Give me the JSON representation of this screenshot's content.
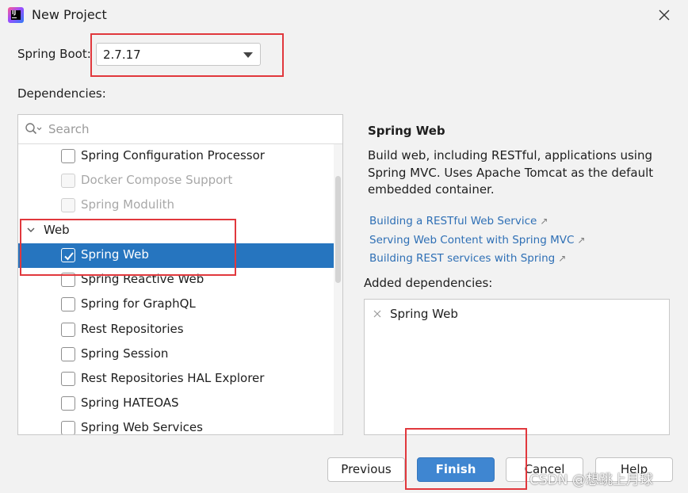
{
  "window": {
    "title": "New Project",
    "app_icon": "intellij-idea-icon",
    "close_icon": "close-icon"
  },
  "spring_boot": {
    "label": "Spring Boot:",
    "value": "2.7.17"
  },
  "dependencies": {
    "label": "Dependencies:",
    "search_placeholder": "Search",
    "rows": [
      {
        "label": "Spring Configuration Processor",
        "type": "item",
        "checked": false,
        "disabled": false
      },
      {
        "label": "Docker Compose Support",
        "type": "item",
        "checked": false,
        "disabled": true
      },
      {
        "label": "Spring Modulith",
        "type": "item",
        "checked": false,
        "disabled": true
      },
      {
        "label": "Web",
        "type": "group",
        "expanded": true
      },
      {
        "label": "Spring Web",
        "type": "item",
        "checked": true,
        "disabled": false,
        "selected": true
      },
      {
        "label": "Spring Reactive Web",
        "type": "item",
        "checked": false,
        "disabled": false
      },
      {
        "label": "Spring for GraphQL",
        "type": "item",
        "checked": false,
        "disabled": false
      },
      {
        "label": "Rest Repositories",
        "type": "item",
        "checked": false,
        "disabled": false
      },
      {
        "label": "Spring Session",
        "type": "item",
        "checked": false,
        "disabled": false
      },
      {
        "label": "Rest Repositories HAL Explorer",
        "type": "item",
        "checked": false,
        "disabled": false
      },
      {
        "label": "Spring HATEOAS",
        "type": "item",
        "checked": false,
        "disabled": false
      },
      {
        "label": "Spring Web Services",
        "type": "item",
        "checked": false,
        "disabled": false
      }
    ]
  },
  "detail": {
    "title": "Spring Web",
    "description": "Build web, including RESTful, applications using Spring MVC. Uses Apache Tomcat as the default embedded container.",
    "links": [
      {
        "label": "Building a RESTful Web Service",
        "icon": "external-link-icon"
      },
      {
        "label": "Serving Web Content with Spring MVC",
        "icon": "external-link-icon"
      },
      {
        "label": "Building REST services with Spring",
        "icon": "external-link-icon"
      }
    ]
  },
  "added": {
    "label": "Added dependencies:",
    "items": [
      "Spring Web"
    ]
  },
  "buttons": {
    "previous": "Previous",
    "finish": "Finish",
    "cancel": "Cancel",
    "help": "Help"
  },
  "watermark": "CSDN @想跳上月球",
  "colors": {
    "accent": "#2675bf",
    "primary_button": "#3f86d1",
    "link": "#2e6fb5",
    "highlight": "#e1383d"
  }
}
